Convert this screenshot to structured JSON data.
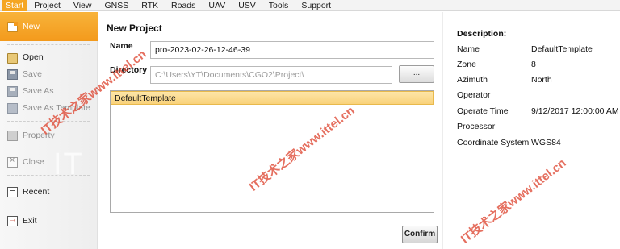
{
  "menubar": {
    "items": [
      "Start",
      "Project",
      "View",
      "GNSS",
      "RTK",
      "Roads",
      "UAV",
      "USV",
      "Tools",
      "Support"
    ]
  },
  "sidebar": {
    "items": [
      {
        "label": "New",
        "icon": "new-file-icon",
        "state": "selected"
      },
      {
        "label": "Open",
        "icon": "open-folder-icon",
        "state": "enabled"
      },
      {
        "label": "Save",
        "icon": "save-icon",
        "state": "disabled"
      },
      {
        "label": "Save As",
        "icon": "save-as-icon",
        "state": "disabled"
      },
      {
        "label": "Save As Template",
        "icon": "save-template-icon",
        "state": "disabled"
      },
      {
        "label": "Property",
        "icon": "property-icon",
        "state": "disabled"
      },
      {
        "label": "Close",
        "icon": "close-icon",
        "state": "disabled"
      },
      {
        "label": "Recent",
        "icon": "recent-icon",
        "state": "enabled"
      },
      {
        "label": "Exit",
        "icon": "exit-icon",
        "state": "enabled"
      }
    ]
  },
  "main": {
    "title": "New Project",
    "name_label": "Name",
    "name_value": "pro-2023-02-26-12-46-39",
    "directory_label": "Directory",
    "directory_value": "C:\\Users\\YT\\Documents\\CGO2\\Project\\",
    "browse_label": "...",
    "templates": [
      "DefaultTemplate"
    ],
    "confirm_label": "Confirm"
  },
  "description": {
    "title": "Description:",
    "rows": [
      {
        "key": "Name",
        "value": "DefaultTemplate"
      },
      {
        "key": "Zone",
        "value": "8"
      },
      {
        "key": "Azimuth",
        "value": "North"
      },
      {
        "key": "Operator",
        "value": ""
      },
      {
        "key": "Operate Time",
        "value": "9/12/2017 12:00:00 AM"
      },
      {
        "key": "Processor",
        "value": ""
      },
      {
        "key": "Coordinate System",
        "value": "WGS84"
      }
    ]
  },
  "watermark": {
    "text": "IT技术之家www.ittel.cn",
    "big_text": "IT"
  },
  "colors": {
    "accent": "#f5a623",
    "selection": "#fde6a9",
    "watermark": "#de4632"
  }
}
